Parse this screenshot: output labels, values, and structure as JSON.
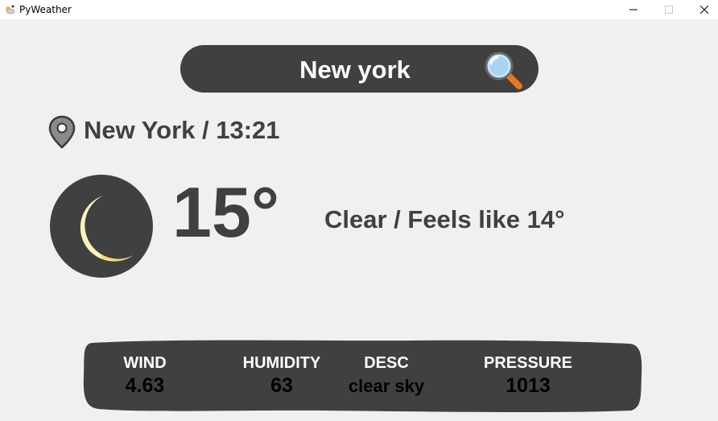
{
  "window": {
    "title": "PyWeather",
    "icon": "pyweather-app-icon"
  },
  "search": {
    "value": "New york",
    "button_icon": "magnifier-icon"
  },
  "location": {
    "icon": "map-pin-icon",
    "text": "New York / 13:21"
  },
  "current": {
    "icon": "crescent-moon-icon",
    "temperature": "15°",
    "condition_line": "Clear / Feels like 14°"
  },
  "stats": {
    "wind": {
      "label": "WIND",
      "value": "4.63"
    },
    "humidity": {
      "label": "HUMIDITY",
      "value": "63"
    },
    "desc": {
      "label": "DESC",
      "value": "clear sky"
    },
    "pressure": {
      "label": "PRESSURE",
      "value": "1013"
    }
  },
  "colors": {
    "panel": "#404040",
    "background": "#f0f0f0",
    "moon_light": "#fff3b8",
    "moon_dark": "#f8dc78",
    "magnifier_handle": "#e87722"
  }
}
